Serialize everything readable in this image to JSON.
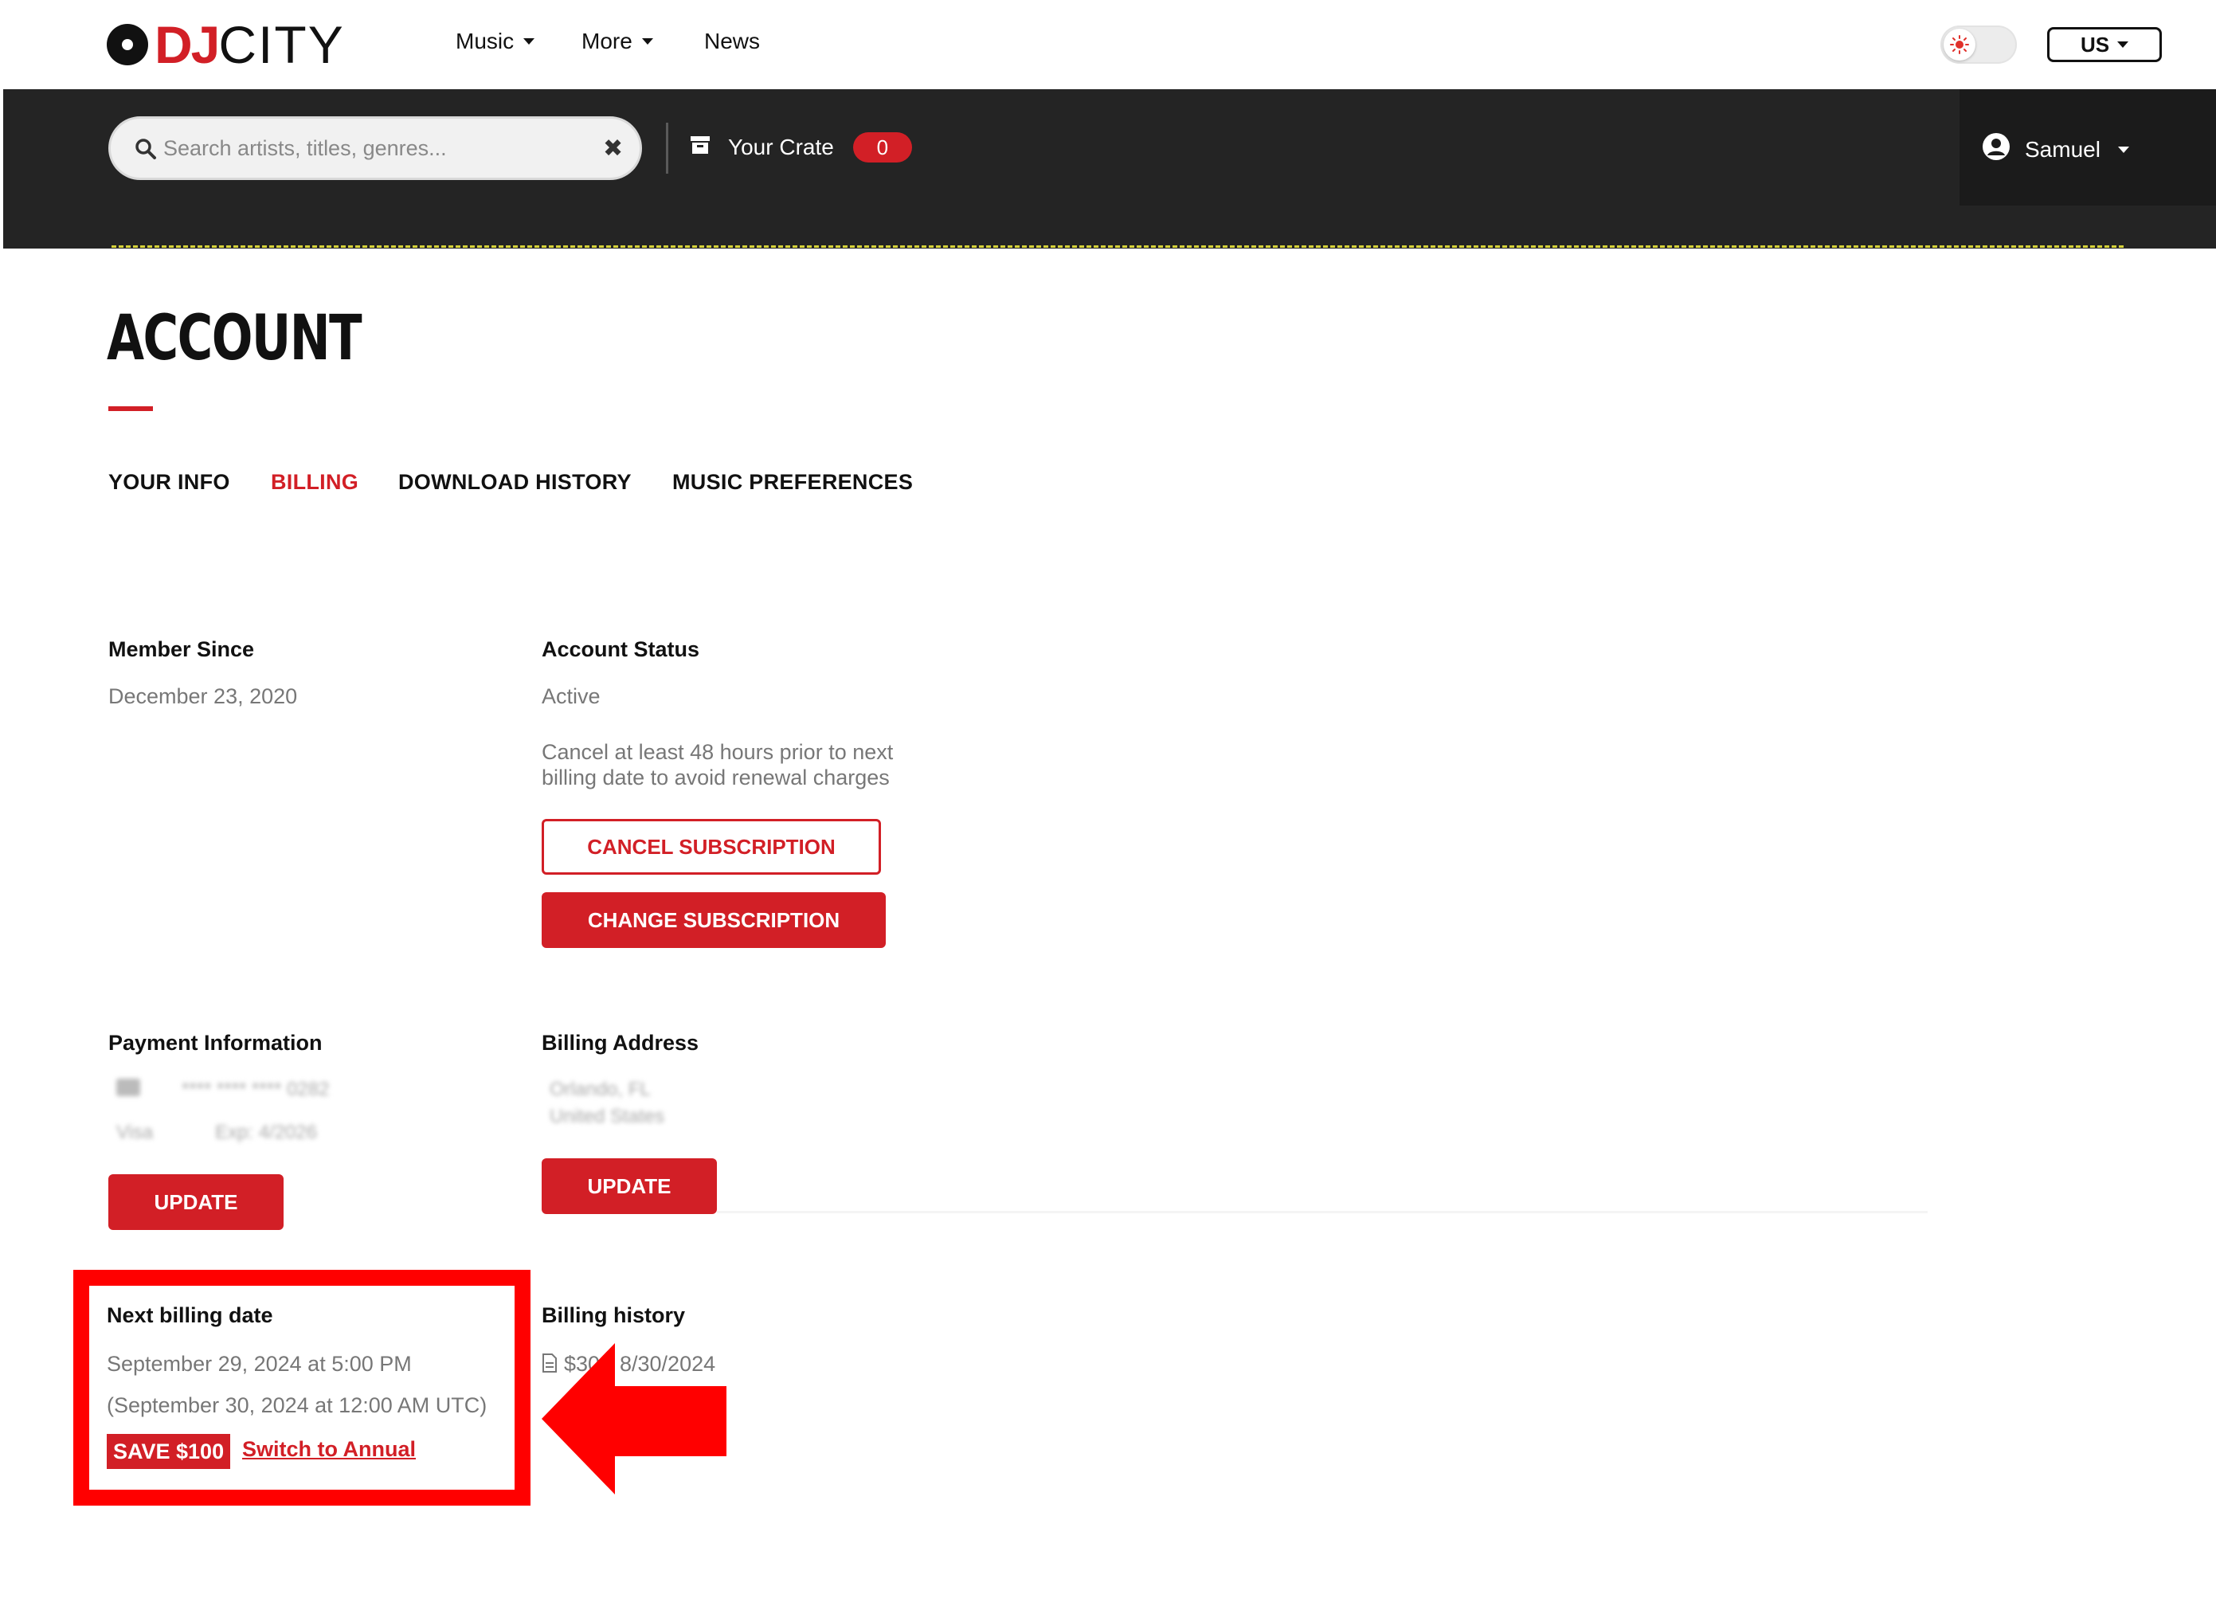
{
  "brand": {
    "logo_dj": "DJ",
    "logo_city": "CITY",
    "accent": "#d21f26"
  },
  "nav": {
    "links": [
      {
        "label": "Music",
        "has_dropdown": true
      },
      {
        "label": "More",
        "has_dropdown": true
      },
      {
        "label": "News",
        "has_dropdown": false
      }
    ],
    "theme_toggle_icon": "sun-icon",
    "country": "US"
  },
  "toolbar": {
    "search_placeholder": "Search artists, titles, genres...",
    "crate_label": "Your Crate",
    "crate_count": "0",
    "user_name": "Samuel"
  },
  "page": {
    "title": "ACCOUNT",
    "tabs": [
      {
        "label": "YOUR INFO",
        "active": false
      },
      {
        "label": "BILLING",
        "active": true
      },
      {
        "label": "DOWNLOAD HISTORY",
        "active": false
      },
      {
        "label": "MUSIC PREFERENCES",
        "active": false
      }
    ]
  },
  "billing": {
    "member_since": {
      "heading": "Member Since",
      "value": "December 23, 2020"
    },
    "account_status": {
      "heading": "Account Status",
      "value": "Active",
      "note_line1": "Cancel at least 48 hours prior to next",
      "note_line2": "billing date to avoid renewal charges",
      "cancel_label": "CANCEL SUBSCRIPTION",
      "change_label": "CHANGE SUBSCRIPTION"
    },
    "payment_information": {
      "heading": "Payment Information",
      "card_number": "**** **** **** 0282",
      "card_type": "Visa",
      "card_expiry": "Exp: 4/2026",
      "update_label": "UPDATE"
    },
    "billing_address": {
      "heading": "Billing Address",
      "line1": "Orlando, FL",
      "line2": "United States",
      "update_label": "UPDATE"
    },
    "next_billing": {
      "heading": "Next billing date",
      "local": "September 29, 2024 at 5:00 PM",
      "utc": "(September 30, 2024 at 12:00 AM UTC)",
      "save_badge": "SAVE $100",
      "switch_link": "Switch to Annual"
    },
    "billing_history": {
      "heading": "Billing history",
      "entry_prefix": "$30",
      "entry_date": "8/30/2024"
    }
  }
}
